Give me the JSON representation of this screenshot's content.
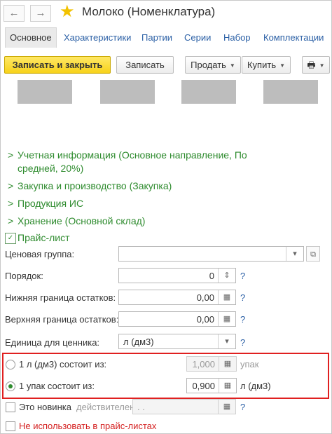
{
  "window": {
    "title": "Молоко (Номенклатура)",
    "back_icon": "←",
    "forward_icon": "→",
    "favorite_icon": "★"
  },
  "tabs": [
    "Основное",
    "Характеристики",
    "Партии",
    "Серии",
    "Набор",
    "Комплектации"
  ],
  "toolbar": {
    "save_close": "Записать и закрыть",
    "save": "Записать",
    "sell": "Продать",
    "buy": "Купить",
    "print_icon": "🖶"
  },
  "sections": {
    "accounting": "Учетная информация (Основное направление, По",
    "accounting_line2": "средней, 20%)",
    "purchase": "Закупка и производство (Закупка)",
    "products": "Продукция ИС",
    "storage": "Хранение (Основной склад)",
    "pricelist": "Прайс-лист"
  },
  "form": {
    "price_group_label": "Ценовая группа:",
    "price_group_value": "",
    "order_label": "Порядок:",
    "order_value": "0",
    "min_stock_label": "Нижняя граница остатков:",
    "min_stock_value": "0,00",
    "max_stock_label": "Верхняя граница остатков:",
    "max_stock_value": "0,00",
    "price_tag_unit_label": "Единица для ценника:",
    "price_tag_unit_value": "л (дм3)",
    "help": "?",
    "radio1_label": "1 л (дм3) состоит из:",
    "radio1_value": "1,000",
    "radio1_unit": "упак",
    "radio2_label": "1 упак состоит из:",
    "radio2_value": "0,900",
    "radio2_unit": "л (дм3)",
    "new_label": "Это новинка",
    "valid_until_label": "действителен до:",
    "valid_until_value": ". .",
    "exclude_label": "Не использовать в прайс-листах"
  },
  "colors": {
    "accent_green": "#2e8b2e",
    "link_blue": "#2a5fa5",
    "primary_yellow": "#f7d21a",
    "highlight_red": "#e02020",
    "exclude_red": "#d42020"
  }
}
